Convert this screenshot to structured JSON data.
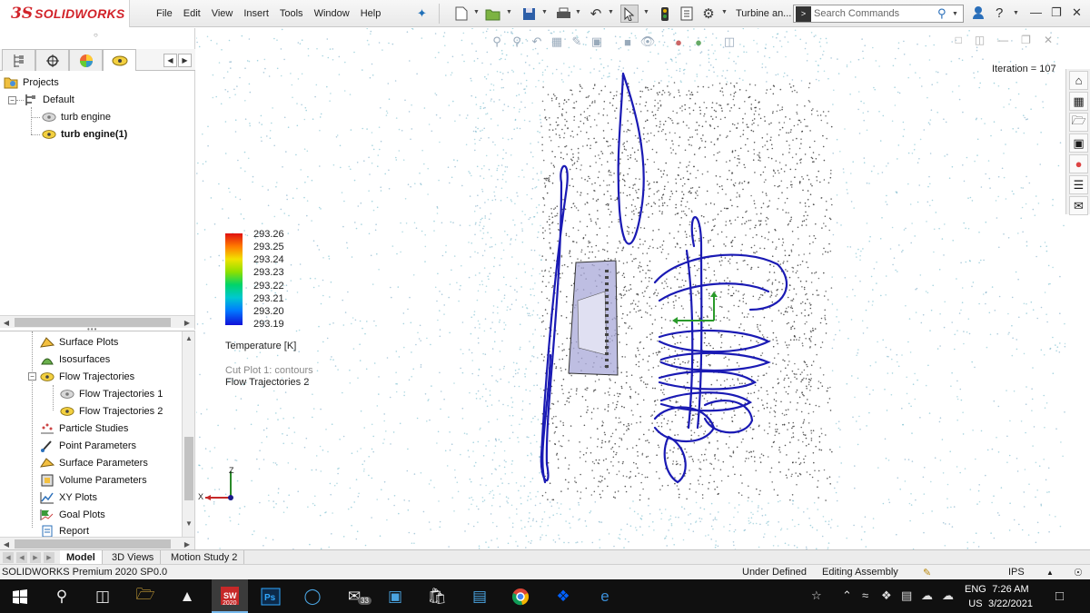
{
  "app": {
    "logo_prefix": "3S",
    "logo_text": "SOLIDWORKS",
    "document_title": "Turbine an...",
    "search_placeholder": "Search Commands"
  },
  "menu": [
    "File",
    "Edit",
    "View",
    "Insert",
    "Tools",
    "Window",
    "Help"
  ],
  "project_tree": {
    "root_label": "Projects",
    "config_label": "Default",
    "items": [
      {
        "label": "turb engine",
        "bold": false
      },
      {
        "label": "turb engine(1)",
        "bold": true
      }
    ]
  },
  "results_tree": {
    "items": [
      {
        "label": "Surface Plots",
        "icon": "surface-plots-icon"
      },
      {
        "label": "Isosurfaces",
        "icon": "isosurfaces-icon"
      },
      {
        "label": "Flow Trajectories",
        "icon": "flow-trajectories-icon"
      },
      {
        "label": "Flow Trajectories 1",
        "icon": "trajectory-icon"
      },
      {
        "label": "Flow Trajectories 2",
        "icon": "trajectory-icon"
      },
      {
        "label": "Particle Studies",
        "icon": "particle-studies-icon"
      },
      {
        "label": "Point Parameters",
        "icon": "point-parameters-icon"
      },
      {
        "label": "Surface Parameters",
        "icon": "surface-parameters-icon"
      },
      {
        "label": "Volume Parameters",
        "icon": "volume-parameters-icon"
      },
      {
        "label": "XY Plots",
        "icon": "xy-plots-icon"
      },
      {
        "label": "Goal Plots",
        "icon": "goal-plots-icon"
      },
      {
        "label": "Report",
        "icon": "report-icon"
      }
    ]
  },
  "viewport": {
    "iteration": "Iteration = 107",
    "legend_title": "Temperature [K]",
    "legend_ticks": [
      "293.26",
      "293.25",
      "293.24",
      "293.23",
      "293.22",
      "293.21",
      "293.20",
      "293.19"
    ],
    "cut_plot_label": "Cut Plot 1: contours",
    "trajectory_label": "Flow Trajectories 2",
    "triad": {
      "z": "Z",
      "x": "X"
    }
  },
  "bottom_tabs": [
    {
      "label": "Model",
      "active": true
    },
    {
      "label": "3D Views",
      "active": false
    },
    {
      "label": "Motion Study 2",
      "active": false
    }
  ],
  "status_bar": {
    "product": "SOLIDWORKS Premium 2020 SP0.0",
    "state": "Under Defined",
    "mode": "Editing Assembly",
    "units": "IPS"
  },
  "taskbar": {
    "sw_badge": "2020",
    "mail_badge": "33",
    "lang_top": "ENG",
    "lang_bottom": "US",
    "time": "7:26 AM",
    "date": "3/22/2021"
  },
  "colors": {
    "brand_red": "#d2232a",
    "trajectory_blue": "#1a1ab4",
    "accent_blue": "#2a6fba"
  }
}
